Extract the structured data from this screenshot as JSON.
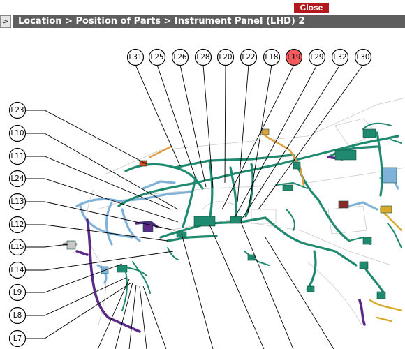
{
  "close_label": "Close",
  "expand_label": ">",
  "title": "Location > Position of Parts > Instrument Panel (LHD) 2",
  "colors": {
    "close_bg": "#b3181d",
    "title_bg": "#5e5e5e",
    "highlight": "#f05c5c",
    "harness_green": "#1f8a70",
    "harness_blue": "#7fb2d8",
    "harness_purple": "#5a2a86",
    "harness_orange": "#e0a040"
  },
  "top_labels": [
    "L31",
    "L25",
    "L26",
    "L28",
    "L20",
    "L22",
    "L18",
    "L19",
    "L29",
    "L32",
    "L30"
  ],
  "left_labels": [
    "L23",
    "L10",
    "L11",
    "L24",
    "L13",
    "L12",
    "L15",
    "L14",
    "L9",
    "L8",
    "L7"
  ],
  "highlighted_label": "L19"
}
